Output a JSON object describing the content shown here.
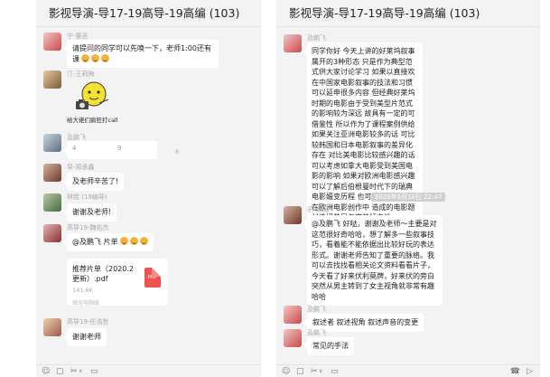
{
  "left": {
    "title": "影视导演-导17-19高导-19高编 (103)",
    "messages": [
      {
        "sender": "宁-董丞",
        "text": "请提问的同学可以先唤一下，老师1:00还有课"
      },
      {
        "sender": "汀-王莉梅",
        "sticker_caption": "给大佬们疯狂打call"
      },
      {
        "sender": "及鹏飞",
        "text_line1": "4",
        "text_line2": "9",
        "side_mark": "8"
      },
      {
        "sender": "导-郑承鑫",
        "text": "及老师辛苦了!"
      },
      {
        "sender": "林煜 (19编导)",
        "text": "谢谢及老师!"
      },
      {
        "sender": "高导19-魏佑杰",
        "text": "@及鹏飞 片单"
      },
      {
        "file_name": "推荐片单（2020.2 更新）.pdf",
        "file_size": "141.6K",
        "file_badge": "PDF",
        "file_source": "微信电脑版"
      },
      {
        "sender": "高导19-任浩哲",
        "text": "谢谢老师"
      }
    ],
    "toolbar": {
      "emoji_icon": "☺",
      "folder_icon": "▢",
      "scissors_icon": "✂",
      "scissors_arrow": "∨",
      "bubble_icon": "▭"
    }
  },
  "right": {
    "title": "影视导演-导17-19高导-19高编 (103)",
    "messages": [
      {
        "sender": "及鹏飞",
        "text": "同学你好 今天上讲的好莱坞叙事属开的3种形态 只是作为典型范式供大家讨论学习 如果以直接欢在中国家电影叙事的技法和习惯 可以延申很多内容 但经典好莱坞时期的电影由于受到美型片范式的影响较为深远 故具有一定的可借鉴性 所以作为了课程案例供给 如果关注亚洲电影较多的话 可比较韩国和日本电影叙事的差异化存在 对比美电影比较感兴趣的话 可以考虑如拿大电影受到美国电影的影响 如果对欧洲电影感兴趣 可以了解后伯根曼时代下的瑞典电影嬗变历程 也可了解独立制片在欧洲电影创作中 造成的电影题材选择差异与审美倾向性"
      },
      {
        "timestamp": "2020年3月10日 22:47"
      },
      {
        "sender": "乐-尚瑶",
        "text": "@及鹏飞 好哒，谢谢及老师～主要是对这范很好奇哈哈，想了解多一些叙事技巧，看着能不能依据出比较好玩的表达形式。谢谢老师告知了重要的脉络。我可以去找找看相关论文资料看看片子，今天看了好来伏利莫牌，好来伏的旁白突然从男主转到了女主视角就非常有趣哈哈"
      },
      {
        "sender": "及鹏飞",
        "text": "叙述者 叙述视角 叙述声音的变更"
      },
      {
        "sender": "及鹏飞",
        "text": "常见的手法"
      }
    ],
    "toolbar": {
      "emoji_icon": "☺",
      "folder_icon": "▢",
      "scissors_icon": "✂",
      "scissors_arrow": "∨",
      "bubble_icon": "▭",
      "phone_icon": "☎",
      "video_icon": "▷"
    }
  }
}
